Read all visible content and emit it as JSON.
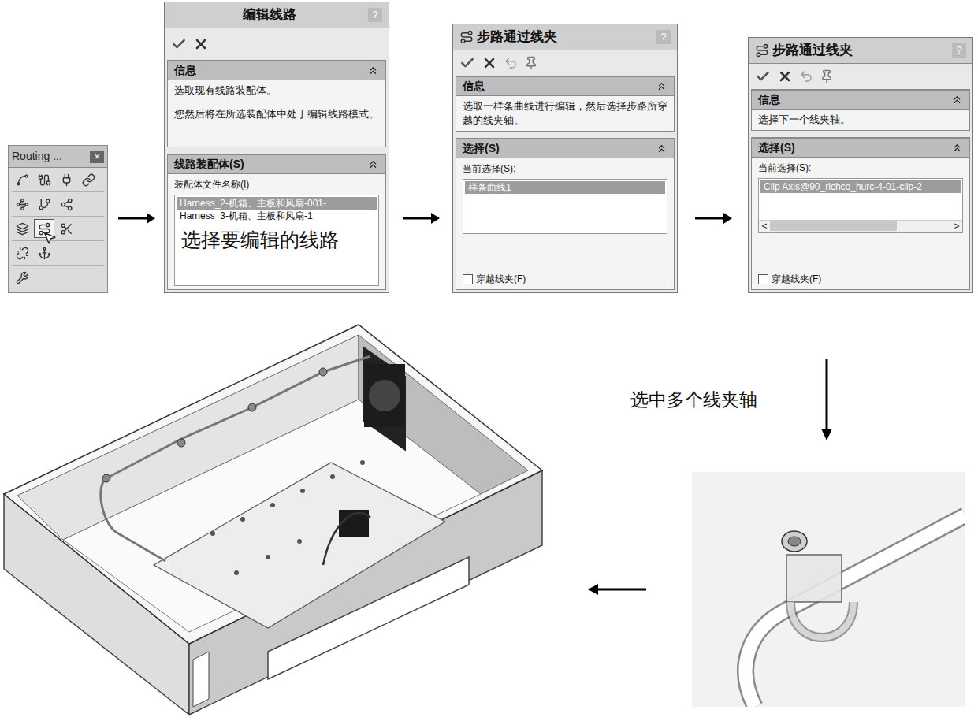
{
  "toolbar": {
    "title": "Routing ...",
    "close": "×",
    "rows": [
      [
        {
          "selected": false
        },
        {
          "selected": false
        },
        {
          "selected": false
        },
        {
          "selected": false
        }
      ],
      [
        {
          "selected": false
        },
        {
          "selected": false
        },
        {
          "selected": false
        }
      ],
      [
        {
          "selected": false
        },
        {
          "selected": true
        },
        {
          "selected": false
        }
      ],
      [
        {
          "selected": false
        },
        {
          "selected": false
        }
      ],
      [
        {
          "selected": false
        }
      ]
    ]
  },
  "panels": [
    {
      "kind": "edit-route",
      "title": "编辑线路",
      "help": "?",
      "info_title": "信息",
      "info": [
        "选取现有线路装配体。",
        "您然后将在所选装配体中处于编辑线路模式。"
      ],
      "section_title": "线路装配体(S)",
      "field_label": "装配体文件名称(I)",
      "items": [
        {
          "label": "Harness_2-机箱、主板和风扇-001-",
          "selected": true
        },
        {
          "label": "Harness_3-机箱、主板和风扇-1",
          "selected": false
        }
      ],
      "annotation": "选择要编辑的线路"
    },
    {
      "kind": "step-route",
      "title": "步路通过线夹",
      "help": "?",
      "info_title": "信息",
      "info": [
        "选取一样条曲线进行编辑，然后选择步路所穿越的线夹轴。"
      ],
      "section_title": "选择(S)",
      "field_label": "当前选择(S):",
      "items": [
        {
          "label": "样条曲线1",
          "selected": true
        }
      ],
      "checkbox": {
        "label": "穿越线夹(F)",
        "checked": false
      }
    },
    {
      "kind": "step-route",
      "title": "步路通过线夹",
      "help": "?",
      "info_title": "信息",
      "info": [
        "选择下一个线夹轴。"
      ],
      "section_title": "选择(S)",
      "field_label": "当前选择(S):",
      "items": [
        {
          "label": "Clip Axis@90_richco_hurc-4-01-clip-2",
          "selected": true
        }
      ],
      "scrollbar": {
        "left": "<",
        "right": ">",
        "level": 0.7
      },
      "checkbox": {
        "label": "穿越线夹(F)",
        "checked": false
      }
    }
  ],
  "flow_label": "选中多个线夹轴"
}
